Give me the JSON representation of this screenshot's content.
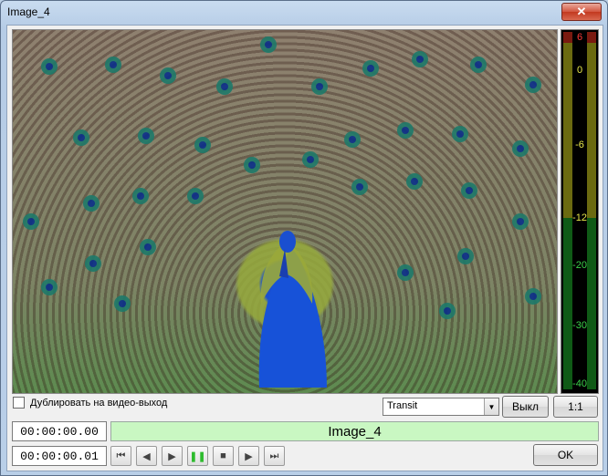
{
  "window": {
    "title": "Image_4",
    "close_glyph": "✕"
  },
  "preview": {
    "alt": "peacock displaying feathers"
  },
  "meter": {
    "ticks": [
      "6",
      "0",
      "-6",
      "-12",
      "-20",
      "-30",
      "-40"
    ]
  },
  "options": {
    "duplicate_label": "Дублировать на видео-выход",
    "transition_value": "Transit",
    "off_label": "Выкл",
    "ratio_label": "1:1"
  },
  "timecodes": {
    "current": "00:00:00.00",
    "duration": "00:00:00.01"
  },
  "clip": {
    "name": "Image_4"
  },
  "transport": {
    "to_start_glyph": "⏮",
    "prev_frame_glyph": "◀",
    "play_glyph": "▶",
    "pause_glyph": "❚❚",
    "stop_glyph": "■",
    "next_frame_glyph": "▶",
    "to_end_glyph": "⏭"
  },
  "footer": {
    "ok_label": "OK"
  },
  "colors": {
    "name_bar": "#c9f7c2",
    "close_button": "#c2381f"
  }
}
